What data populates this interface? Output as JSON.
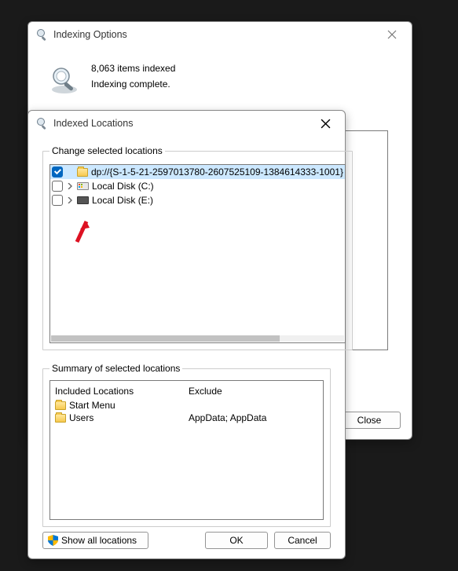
{
  "opts_window": {
    "title": "Indexing Options",
    "items_indexed": "8,063 items indexed",
    "status": "Indexing complete.",
    "close_label": "Close"
  },
  "loc_window": {
    "title": "Indexed Locations",
    "change_legend": "Change selected locations",
    "tree": [
      {
        "checked": true,
        "expandable": false,
        "icon": "folder",
        "label": "dp://{S-1-5-21-2597013780-2607525109-1384614333-1001}",
        "selected": true
      },
      {
        "checked": false,
        "expandable": true,
        "icon": "drive-win",
        "label": "Local Disk (C:)",
        "selected": false
      },
      {
        "checked": false,
        "expandable": true,
        "icon": "drive-dark",
        "label": "Local Disk (E:)",
        "selected": false
      }
    ],
    "summary_legend": "Summary of selected locations",
    "col_included": "Included Locations",
    "col_exclude": "Exclude",
    "included": [
      {
        "label": "Start Menu",
        "exclude": ""
      },
      {
        "label": "Users",
        "exclude": "AppData; AppData"
      }
    ],
    "show_all_label": "Show all locations",
    "ok_label": "OK",
    "cancel_label": "Cancel"
  }
}
